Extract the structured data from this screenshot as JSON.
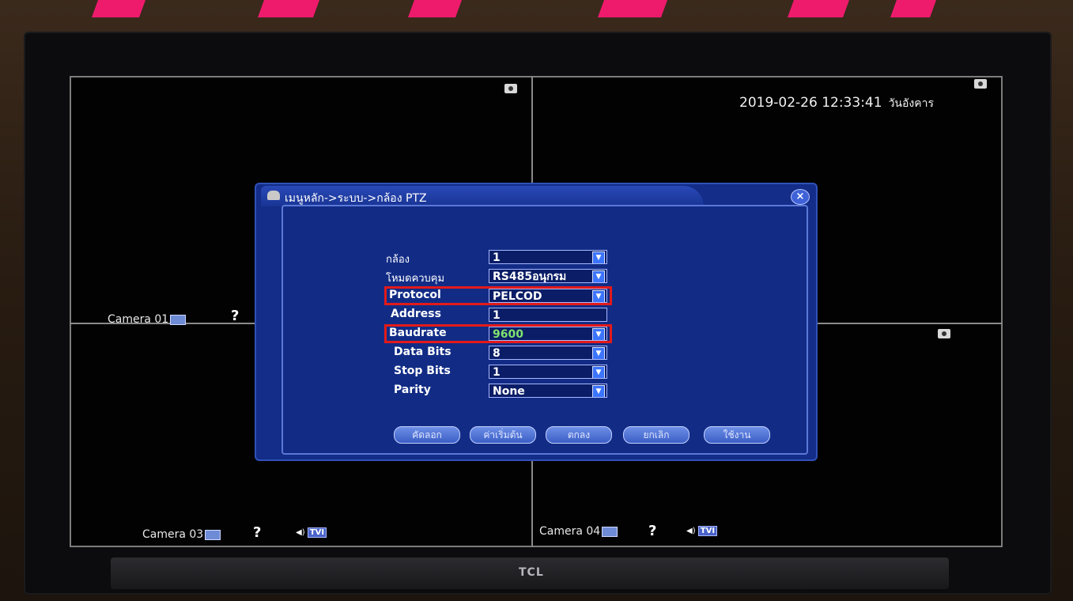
{
  "clock": {
    "datetime": "2019-02-26 12:33:41",
    "day": "วันอังคาร"
  },
  "monitor": {
    "brand": "TCL"
  },
  "cameras": [
    {
      "label": "Camera 01"
    },
    {
      "label": "Camera 03"
    },
    {
      "label": "Camera 04"
    }
  ],
  "help_glyph": "?",
  "tvi_label": "TVI",
  "dialog": {
    "title": "เมนูหลัก->ระบบ->กล้อง PTZ",
    "close": "×",
    "rows": [
      {
        "label": "กล้อง",
        "value": "1"
      },
      {
        "label": "โหมดควบคุม",
        "value": "RS485อนุกรม"
      },
      {
        "label": "Protocol",
        "value": "PELCOD"
      },
      {
        "label": "Address",
        "value": "1"
      },
      {
        "label": "Baudrate",
        "value": "9600"
      },
      {
        "label": "Data Bits",
        "value": "8"
      },
      {
        "label": "Stop Bits",
        "value": "1"
      },
      {
        "label": "Parity",
        "value": "None"
      }
    ],
    "buttons": [
      "คัดลอก",
      "ค่าเริ่มต้น",
      "ตกลง",
      "ยกเลิก",
      "ใช้งาน"
    ]
  },
  "colors": {
    "highlight": "#e31a1a",
    "dialog_bg": "#132d88",
    "accent": "#3b74ff"
  }
}
